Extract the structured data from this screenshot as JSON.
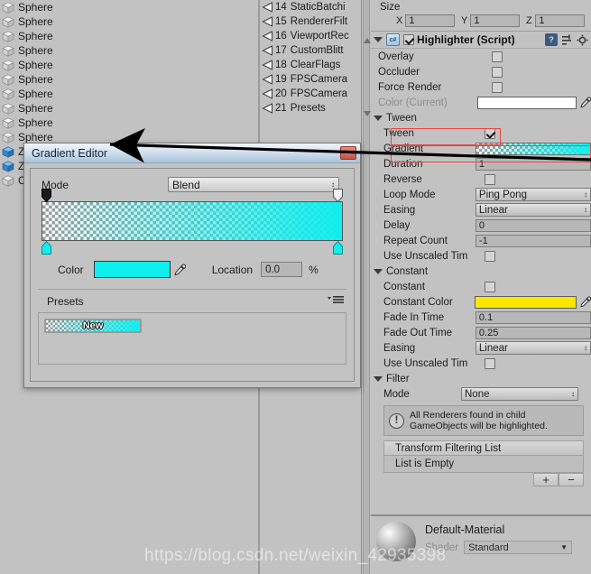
{
  "hierarchy": {
    "items": [
      {
        "label": "Sphere",
        "icon": "cube-icon"
      },
      {
        "label": "Sphere",
        "icon": "cube-icon"
      },
      {
        "label": "Sphere",
        "icon": "cube-icon"
      },
      {
        "label": "Sphere",
        "icon": "cube-icon"
      },
      {
        "label": "Sphere",
        "icon": "cube-icon"
      },
      {
        "label": "Sphere",
        "icon": "cube-icon"
      },
      {
        "label": "Sphere",
        "icon": "cube-icon"
      },
      {
        "label": "Sphere",
        "icon": "cube-icon"
      },
      {
        "label": "Sphere",
        "icon": "cube-icon"
      },
      {
        "label": "Sphere",
        "icon": "cube-icon"
      },
      {
        "label": "Zo",
        "icon": "prefab-icon"
      },
      {
        "label": "Zo",
        "icon": "prefab-icon"
      },
      {
        "label": "C",
        "icon": "cube-icon"
      }
    ]
  },
  "scene_list": {
    "items": [
      {
        "index": "14",
        "label": "StaticBatchi"
      },
      {
        "index": "15",
        "label": "RendererFilt"
      },
      {
        "index": "16",
        "label": "ViewportRec"
      },
      {
        "index": "17",
        "label": "CustomBlitt"
      },
      {
        "index": "18",
        "label": "ClearFlags"
      },
      {
        "index": "19",
        "label": "FPSCamera"
      },
      {
        "index": "20",
        "label": "FPSCamera"
      },
      {
        "index": "21",
        "label": "Presets"
      }
    ]
  },
  "inspector": {
    "size": {
      "label": "Size",
      "x_label": "X",
      "x_value": "1",
      "y_label": "Y",
      "y_value": "1",
      "z_label": "Z",
      "z_value": "1"
    },
    "component": {
      "title": "Highlighter (Script)",
      "enabled": true,
      "script_badge": "c#",
      "help_icon": "help-icon",
      "preset_icon": "preset-icon",
      "gear_icon": "gear-icon"
    },
    "top_fields": [
      {
        "label": "Overlay",
        "type": "checkbox",
        "checked": false
      },
      {
        "label": "Occluder",
        "type": "checkbox",
        "checked": false
      },
      {
        "label": "Force Render",
        "type": "checkbox",
        "checked": false
      },
      {
        "label": "Color (Current)",
        "type": "color",
        "value": "#ffffff",
        "dimmed": true
      }
    ],
    "tween": {
      "header": "Tween",
      "rows": [
        {
          "label": "Tween",
          "type": "checkbox",
          "checked": true,
          "highlight": true
        },
        {
          "label": "Gradient",
          "type": "gradient",
          "highlight": true
        },
        {
          "label": "Duration",
          "type": "text",
          "value": "1"
        },
        {
          "label": "Reverse",
          "type": "checkbox",
          "checked": false
        },
        {
          "label": "Loop Mode",
          "type": "popup",
          "value": "Ping Pong"
        },
        {
          "label": "Easing",
          "type": "popup",
          "value": "Linear"
        },
        {
          "label": "Delay",
          "type": "text",
          "value": "0"
        },
        {
          "label": "Repeat Count",
          "type": "text",
          "value": "-1"
        },
        {
          "label": "Use Unscaled Tim",
          "type": "checkbox",
          "checked": false
        }
      ]
    },
    "constant": {
      "header": "Constant",
      "rows": [
        {
          "label": "Constant",
          "type": "checkbox",
          "checked": false
        },
        {
          "label": "Constant Color",
          "type": "color",
          "value": "#ffe600"
        },
        {
          "label": "Fade In Time",
          "type": "text",
          "value": "0.1"
        },
        {
          "label": "Fade Out Time",
          "type": "text",
          "value": "0.25"
        },
        {
          "label": "Easing",
          "type": "popup",
          "value": "Linear"
        },
        {
          "label": "Use Unscaled Tim",
          "type": "checkbox",
          "checked": false
        }
      ]
    },
    "filter": {
      "header": "Filter",
      "mode_label": "Mode",
      "mode_value": "None",
      "help_text": "All Renderers found in child GameObjects will be highlighted.",
      "warning_icon": "warning-icon",
      "list_header": "Transform Filtering List",
      "list_empty": "List is Empty",
      "add_label": "+",
      "remove_label": "−"
    },
    "material": {
      "name": "Default-Material",
      "shader_label": "Shader",
      "shader_value": "Standard"
    }
  },
  "gradient_editor": {
    "title": "Gradient Editor",
    "close_label": "×",
    "mode_label": "Mode",
    "mode_value": "Blend",
    "color_label": "Color",
    "color_value": "#10eeee",
    "eyedropper_icon": "eyedropper-icon",
    "location_label": "Location",
    "location_value": "0.0",
    "percent_label": "%",
    "presets_label": "Presets",
    "presets_menu_icon": "hamburger-menu-icon",
    "preset_items": [
      {
        "label": "New"
      }
    ],
    "alpha_keys": [
      {
        "position": 0,
        "alpha": 0
      },
      {
        "position": 100,
        "alpha": 100
      }
    ],
    "color_keys": [
      {
        "position": 0,
        "color": "#10eeee"
      },
      {
        "position": 100,
        "color": "#10eeee"
      }
    ]
  },
  "watermark": {
    "text": "https://blog.csdn.net/weixin_42935398"
  },
  "colors": {
    "panel_bg": "#c2c2c2",
    "accent_cyan": "#10eeee",
    "accent_yellow": "#ffe600",
    "highlight_red": "#e8463c",
    "title_blue": "#a9c3dc"
  }
}
